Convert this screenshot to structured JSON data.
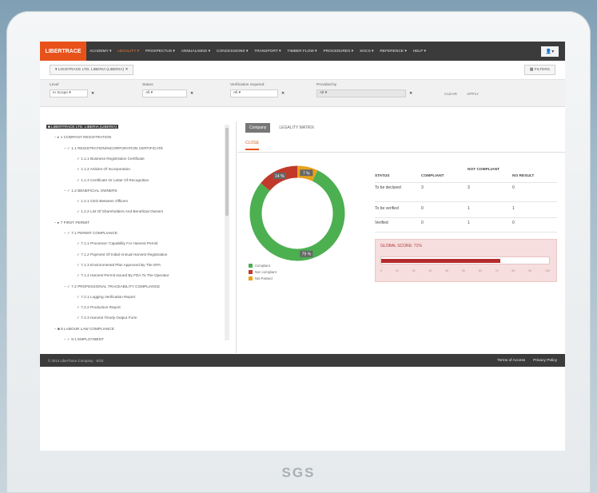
{
  "device": {
    "brand": "SGS"
  },
  "nav": {
    "logo": "LIBERTRACE",
    "items": [
      {
        "label": "ACADEMY ▾",
        "active": false
      },
      {
        "label": "LEGALITY ▾",
        "active": true
      },
      {
        "label": "PROSPECTUS ▾",
        "active": false
      },
      {
        "label": "ANNUALISING ▾",
        "active": false
      },
      {
        "label": "CONCESSIONS ▾",
        "active": false
      },
      {
        "label": "TRANSPORT ▾",
        "active": false
      },
      {
        "label": "TIMBER FLOW ▾",
        "active": false
      },
      {
        "label": "PROCEDURES ▾",
        "active": false
      },
      {
        "label": "SOCS ▾",
        "active": false
      },
      {
        "label": "REFERENCE ▾",
        "active": false
      },
      {
        "label": "HELP ▾",
        "active": false
      }
    ],
    "user_icon": "user-icon"
  },
  "breadcrumb": {
    "label": "▾ LIGISTRACE LTD. LIBERIA (LIBERIA)  ✕",
    "filter_button": "▦ FILTERS"
  },
  "filters": {
    "level": {
      "label": "Level",
      "value": "In Scope"
    },
    "status": {
      "label": "Status",
      "value": "All"
    },
    "verification": {
      "label": "Verification required",
      "value": "All"
    },
    "provided_by": {
      "label": "Provided by",
      "value": "All"
    },
    "clear": "CLEAR",
    "apply": "APPLY"
  },
  "tree": [
    {
      "text": "■ LIBERTRACE LTD. LIBERIA (LIBERIA)",
      "indent": 0,
      "root": true
    },
    {
      "text": "− ▸ 1 COMPANY REGISTRATION",
      "indent": 1
    },
    {
      "text": "− ✓ 1.1 REGISTRATION/INCORPORATION CERTIFICATE",
      "indent": 2
    },
    {
      "text": "✓ 1.1.1 Business Registration Certificate",
      "indent": 3
    },
    {
      "text": "✓ 1.1.2 Articles Of Incorporation",
      "indent": 3
    },
    {
      "text": "✓ 1.1.3 Certificate Or Letter Of Recognition",
      "indent": 3
    },
    {
      "text": "− ✓ 1.2 BENEFICIAL OWNERS",
      "indent": 2
    },
    {
      "text": "✓ 1.2.1 CEO Between Officers",
      "indent": 3
    },
    {
      "text": "✓ 1.2.2 List Of Shareholders And Beneficial Owners",
      "indent": 3
    },
    {
      "text": "− ▸ 7 FIRST PERMIT",
      "indent": 1
    },
    {
      "text": "− ✓ 7.1 PERMIT COMPLIANCE",
      "indent": 2
    },
    {
      "text": "✓ 7.1.1 Processor 'Capability For Harvest Permit",
      "indent": 3
    },
    {
      "text": "✓ 7.1.2 Payment Of Initial Annual Harvest Registration",
      "indent": 3
    },
    {
      "text": "✓ 7.1.3 Environmental Plan Approved By The EPA",
      "indent": 3
    },
    {
      "text": "✓ 7.1.4 Harvest Permit Issued By FDA To The Operator",
      "indent": 3
    },
    {
      "text": "− ✓ 7.2 PROFESSIONAL TRACEABILITY COMPLIANCE",
      "indent": 2
    },
    {
      "text": "✓ 7.2.1 Logging Verification Report",
      "indent": 3
    },
    {
      "text": "✓ 7.2.2 Production Report",
      "indent": 3
    },
    {
      "text": "✓ 7.2.3 Harvest Timely Output Form",
      "indent": 3
    },
    {
      "text": "− ■ 8 LABOUR LAW COMPLIANCE",
      "indent": 1
    },
    {
      "text": "− ✓ 8.1 EMPLOYMENT",
      "indent": 2
    }
  ],
  "tabs": {
    "active": "Company",
    "other": "LEGALITY MATRIX",
    "subtab": "CLOSE"
  },
  "donut": {
    "segments": [
      {
        "name": "Compliant",
        "value": 79,
        "label": "79 %",
        "color": "#4caf50"
      },
      {
        "name": "Non compliant",
        "value": 14,
        "label": "14 %",
        "color": "#c0392b"
      },
      {
        "name": "Not Passed",
        "value": 7,
        "label": "7 %",
        "color": "#e8a21a"
      }
    ]
  },
  "legend": [
    {
      "label": "Compliant",
      "color": "#4caf50"
    },
    {
      "label": "Non compliant",
      "color": "#c0392b"
    },
    {
      "label": "Not Passed",
      "color": "#e8a21a"
    }
  ],
  "status_table": {
    "headers": [
      "STATUS",
      "COMPLIANT",
      "NOT COMPLIANT",
      "NO RESULT"
    ],
    "rows": [
      {
        "status": "To be declared",
        "compliant": "3",
        "not_compliant": "3",
        "no_result": "0"
      },
      {
        "status": "To be verified",
        "compliant": "0",
        "not_compliant": "1",
        "no_result": "1"
      },
      {
        "status": "Verified",
        "compliant": "0",
        "not_compliant": "1",
        "no_result": "0"
      }
    ]
  },
  "score": {
    "label": "GLOBAL SCORE: 71%",
    "value_percent": 71,
    "ticks": [
      "0",
      "10",
      "20",
      "30",
      "40",
      "50",
      "60",
      "70",
      "80",
      "90",
      "100"
    ]
  },
  "footer": {
    "copyright": "© 2014 LiberTrace Company · SGS",
    "links": [
      "Terms of Access",
      "Privacy Policy"
    ]
  }
}
